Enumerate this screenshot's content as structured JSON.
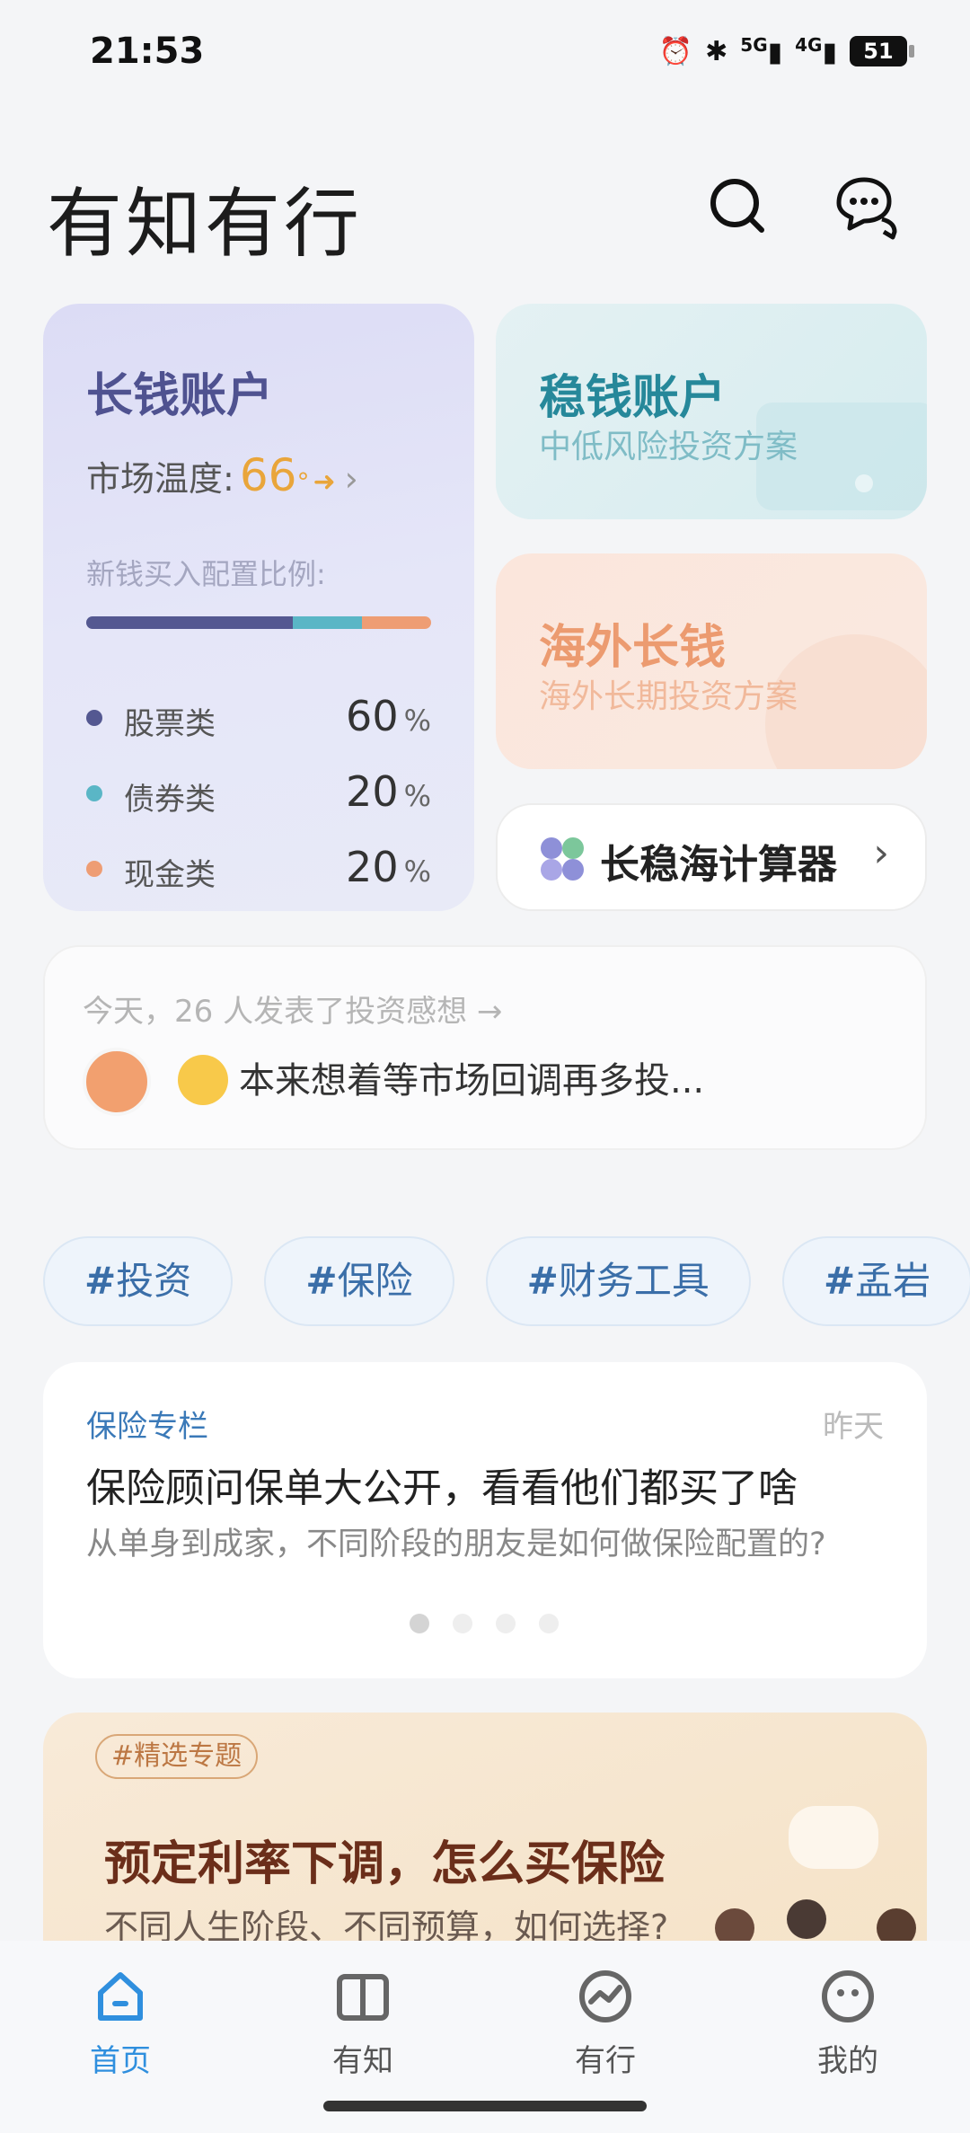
{
  "status_bar": {
    "time": "21:53",
    "battery": "51",
    "signal1": "5G",
    "signal2": "4G"
  },
  "header": {
    "title": "有知有行"
  },
  "long_account": {
    "title": "长钱账户",
    "temp_label": "市场温度:",
    "temp_value": "66",
    "temp_unit": "°",
    "allocation_label": "新钱买入配置比例:",
    "allocation": [
      {
        "name": "股票类",
        "value": "60",
        "unit": "%",
        "percent": 60,
        "color": "#545891"
      },
      {
        "name": "债券类",
        "value": "20",
        "unit": "%",
        "percent": 20,
        "color": "#5ab6c6"
      },
      {
        "name": "现金类",
        "value": "20",
        "unit": "%",
        "percent": 20,
        "color": "#ee9d74"
      }
    ]
  },
  "stable_account": {
    "title": "稳钱账户",
    "subtitle": "中低风险投资方案"
  },
  "overseas_account": {
    "title": "海外长钱",
    "subtitle": "海外长期投资方案"
  },
  "calculator": {
    "label": "长稳海计算器"
  },
  "feed": {
    "header": "今天，26 人发表了投资感想 →",
    "post": "本来想着等市场回调再多投..."
  },
  "tags": [
    {
      "hash": "#",
      "label": "投资"
    },
    {
      "hash": "#",
      "label": "保险"
    },
    {
      "hash": "#",
      "label": "财务工具"
    },
    {
      "hash": "#",
      "label": "孟岩"
    }
  ],
  "article": {
    "column": "保险专栏",
    "date": "昨天",
    "title": "保险顾问保单大公开，看看他们都买了啥",
    "subtitle": "从单身到成家，不同阶段的朋友是如何做保险配置的?",
    "pages": 4,
    "active_page": 1
  },
  "promo": {
    "tag": "#精选专题",
    "title": "预定利率下调，怎么买保险",
    "subtitle": "不同人生阶段、不同预算，如何选择?"
  },
  "tabbar": {
    "items": [
      {
        "label": "首页",
        "icon": "home-icon",
        "active": true
      },
      {
        "label": "有知",
        "icon": "book-icon",
        "active": false
      },
      {
        "label": "有行",
        "icon": "trend-icon",
        "active": false
      },
      {
        "label": "我的",
        "icon": "profile-icon",
        "active": false
      }
    ],
    "accent": "#2f8fde"
  }
}
